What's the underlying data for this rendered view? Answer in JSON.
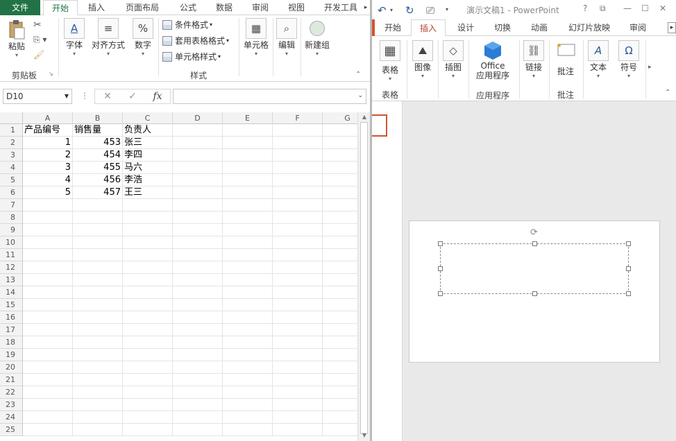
{
  "excel": {
    "tabs": [
      "文件",
      "开始",
      "插入",
      "页面布局",
      "公式",
      "数据",
      "审阅",
      "视图",
      "开发工具"
    ],
    "active_tab": "开始",
    "ribbon": {
      "paste": "粘贴",
      "clipboard_group": "剪贴板",
      "font": "字体",
      "align": "对齐方式",
      "number": "数字",
      "cond_format": "条件格式",
      "table_format": "套用表格格式",
      "cell_style": "单元格样式",
      "styles_group": "样式",
      "cells": "单元格",
      "edit": "编辑",
      "new_group": "新建组"
    },
    "namebox": "D10",
    "fx": "fx",
    "columns": [
      "A",
      "B",
      "C",
      "D",
      "E",
      "F",
      "G"
    ],
    "rows": [
      "1",
      "2",
      "3",
      "4",
      "5",
      "6",
      "7",
      "8",
      "9",
      "10",
      "11",
      "12",
      "13",
      "14",
      "15",
      "16",
      "17",
      "18",
      "19",
      "20",
      "21",
      "22",
      "23",
      "24",
      "25"
    ],
    "cells": {
      "header": [
        "产品编号",
        "销售量",
        "负责人"
      ],
      "data": [
        [
          "1",
          "453",
          "张三"
        ],
        [
          "2",
          "454",
          "李四"
        ],
        [
          "3",
          "455",
          "马六"
        ],
        [
          "4",
          "456",
          "李浩"
        ],
        [
          "5",
          "457",
          "王三"
        ]
      ]
    }
  },
  "ppt": {
    "title": "演示文稿1 - PowerPoint",
    "help": "?",
    "tabs": [
      "开始",
      "插入",
      "设计",
      "切换",
      "动画",
      "幻灯片放映",
      "审阅"
    ],
    "active_tab": "插入",
    "ribbon": {
      "table": "表格",
      "table_group": "表格",
      "image": "图像",
      "illustration": "插图",
      "office_line1": "Office",
      "office_line2": "应用程序",
      "apps_group": "应用程序",
      "link": "链接",
      "comment": "批注",
      "comment_group": "批注",
      "text": "文本",
      "symbol": "符号"
    }
  }
}
